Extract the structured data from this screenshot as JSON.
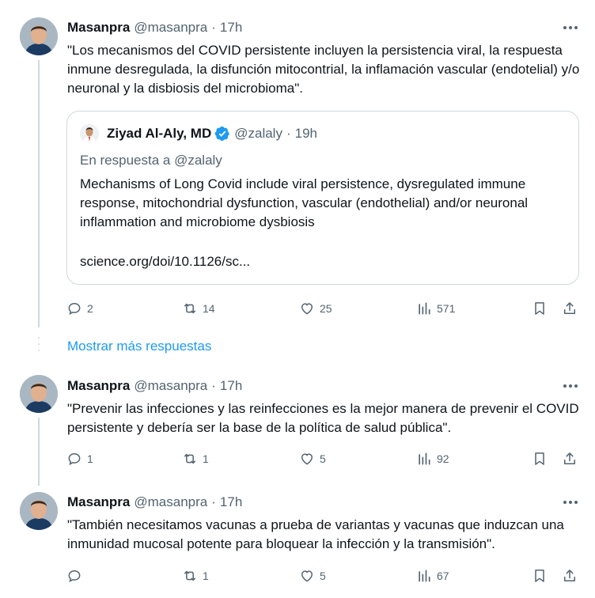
{
  "colors": {
    "accent": "#1d9bf0",
    "muted": "#536471",
    "text": "#0f1419",
    "border": "#cfd9de"
  },
  "tweets": [
    {
      "name": "Masanpra",
      "handle": "@masanpra",
      "sep": "·",
      "time": "17h",
      "text": "\"Los mecanismos del COVID persistente incluyen la persistencia viral, la respuesta inmune desregulada, la disfunción mitocontrial, la inflamación vascular (endotelial) y/o neuronal y la disbiosis del microbioma\".",
      "quote": {
        "name": "Ziyad Al-Aly, MD",
        "handle": "@zalaly",
        "sep": "·",
        "time": "19h",
        "reply_to": "En respuesta a @zalaly",
        "text": "Mechanisms of Long Covid include viral persistence, dysregulated immune response, mitochondrial dysfunction, vascular (endothelial) and/or neuronal inflammation and microbiome dysbiosis",
        "link": "science.org/doi/10.1126/sc..."
      },
      "stats": {
        "replies": "2",
        "retweets": "14",
        "likes": "25",
        "views": "571"
      }
    },
    {
      "name": "Masanpra",
      "handle": "@masanpra",
      "sep": "·",
      "time": "17h",
      "text": "\"Prevenir las infecciones y las reinfecciones es la mejor manera de prevenir el COVID persistente y debería ser la base de la política de salud pública\".",
      "stats": {
        "replies": "1",
        "retweets": "1",
        "likes": "5",
        "views": "92"
      }
    },
    {
      "name": "Masanpra",
      "handle": "@masanpra",
      "sep": "·",
      "time": "17h",
      "text": "\"También necesitamos vacunas a prueba de variantas y vacunas que induzcan una inmunidad mucosal potente para bloquear la infección y la transmisión\".",
      "stats": {
        "replies": "",
        "retweets": "1",
        "likes": "5",
        "views": "67"
      }
    }
  ],
  "show_more_label": "Mostrar más respuestas",
  "icons": [
    "more-icon",
    "reply-icon",
    "retweet-icon",
    "like-icon",
    "views-icon",
    "bookmark-icon",
    "share-icon",
    "verified-icon"
  ]
}
